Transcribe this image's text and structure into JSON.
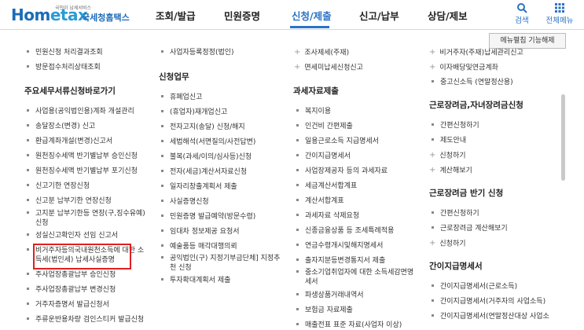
{
  "header": {
    "logo_text_a": "Hom",
    "logo_text_b": "etax",
    "logo_small": "국민이 납세서비스",
    "logo_kor": "국세청홈택스",
    "nav": [
      "조회/발급",
      "민원증명",
      "신청/제출",
      "신고/납부",
      "상담/제보"
    ],
    "active_nav": "신청/제출",
    "search_label": "검색",
    "menu_label": "전체메뉴"
  },
  "menu_off_button": "메뉴펼침 기능해제",
  "col1": {
    "top_items": [
      "민원신청 처리결과조회",
      "방문접수처리상태조회"
    ],
    "section_title": "주요세무서류신청바로가기",
    "items": [
      "사업용(공익법인용)계좌 개설관리",
      "송달장소(변경) 신고",
      "환급계좌개설(변경)신고서",
      "원천징수세액 반기별납부 승인신청",
      "원천징수세액 반기별납부 포기신청",
      "신고기한 연장신청",
      "신고분 납부기한 연장신청",
      "고지분 납부기한등 연장(구,징수유예)\n신청",
      "성실신고확인자 선임 신고서",
      "비거주자등의국내원천소득에 대한 소\n득세(법인세) 납세사실증명",
      "주사업장총괄납부 승인신청",
      "주사업장총괄납부 변경신청",
      "거주자증명서 발급신청서",
      "주류운반용차량 검인스티커 발급신청"
    ]
  },
  "col2": {
    "top_items": [
      "사업자등록정정(법인)"
    ],
    "section_title": "신청업무",
    "items": [
      "휴폐업신고",
      "(휴업자)재개업신고",
      "전자고지(송달) 신청/해지",
      "세법해석(서면질의/사전답변)",
      "불복(과세/이의/심사등)신청",
      "전자(세금)계산서자료신청",
      "일자리창출계획서 제출",
      "사실증명신청",
      "민원증명 발급예약(방문수령)",
      "임대차 정보제공 요청서",
      "예술품등 매각대행의뢰",
      "공익법인(구) 지정기부금단체] 지정추\n천 신청",
      "투자확대계획서 제출"
    ]
  },
  "col3": {
    "top_items": [
      "조사제세(주재)",
      "면세미납세신청신고"
    ],
    "section_title": "과세자료제출",
    "items": [
      "복지이용",
      "인건비 간편제출",
      "일용근로소득 지급명세서",
      "간이지급명세서",
      "사업장제공자 등의 과세자료",
      "세금계산서합계표",
      "계산서합계표",
      "과세자료 삭제요청",
      "신종금융상품 등 조세특례적용",
      "연금수령개시및해지명세서",
      "출자지분등변경통지서 제출",
      "중소기업취업자에 대한 소득세감면명\n세서",
      "파생상품거래내역서",
      "보험금 자료제출",
      "매출전표 표준 자료(사업자 이상)"
    ]
  },
  "col4": {
    "top_items": [
      "비거주자(주재)납세관리신고",
      "이자배당및연금계좌",
      "중고신소득 (연말정산용)"
    ],
    "sections": [
      {
        "title": "근로장려금,자녀장려금신청",
        "items": [
          "간편신청하기",
          "제도안내",
          "신청하기",
          "계산해보기"
        ]
      },
      {
        "title": "근로장려금 반기 신청",
        "items": [
          "간편신청하기",
          "근로장려금 계산해보기",
          "신청하기"
        ]
      },
      {
        "title": "간이지급명세서",
        "items": [
          "간이지급명세서(근로소득)",
          "간이지급명세서(거주자의 사업소득)",
          "간이지급명세서(연말정산대상 사업소"
        ]
      }
    ]
  },
  "colors": {
    "accent": "#2a72c6",
    "highlight": "#e02020"
  }
}
